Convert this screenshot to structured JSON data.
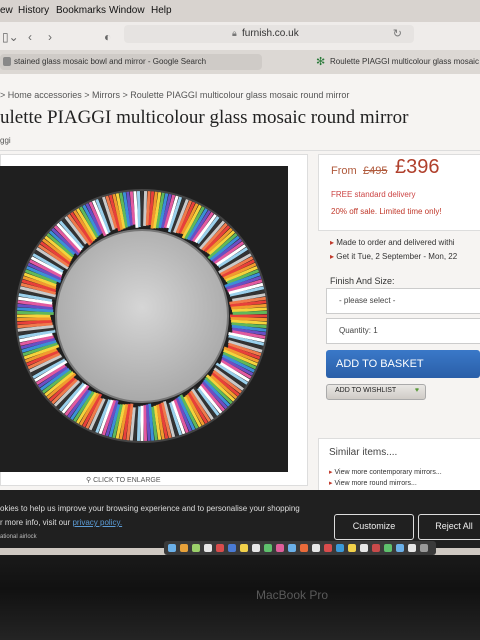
{
  "menubar": {
    "items": [
      "ew",
      "History",
      "Bookmarks",
      "Window",
      "Help"
    ]
  },
  "browser": {
    "url": "furnish.co.uk",
    "tabs": [
      {
        "label": "stained glass mosaic bowl and mirror - Google Search"
      },
      {
        "label": "Roulette PIAGGI multicolour glass mosaic r"
      }
    ]
  },
  "product": {
    "breadcrumb": "> Home accessories > Mirrors > Roulette PIAGGI multicolour glass mosaic round mirror",
    "title": "ulette PIAGGI multicolour glass mosaic round mirror",
    "brand": "ggi",
    "enlarge_label": "CLICK TO ENLARGE",
    "price": {
      "from_label": "From",
      "old_price": "£495",
      "new_price": "£396",
      "delivery": "FREE standard delivery",
      "sale_note": "20% off sale. Limited time only!"
    },
    "details": [
      "Made to order and delivered withi",
      "Get it Tue,  2 September - Mon, 22"
    ],
    "finish_label": "Finish And Size:",
    "finish_select": "- please select -",
    "quantity": "Quantity: 1",
    "add_to_basket": "ADD TO BASKET",
    "add_to_wishlist": "ADD TO WISHLIST",
    "similar_title": "Similar items....",
    "similar_items": [
      "View more contemporary mirrors...",
      "View more round mirrors..."
    ]
  },
  "cookie": {
    "line1": "okies to help us improve your browsing experience and to personalise your shopping",
    "line2_prefix": "r more info, visit our ",
    "privacy_link": "privacy policy.",
    "customize": "Customize",
    "reject_all": "Reject All",
    "status": "ational airlock"
  },
  "laptop_label": "MacBook Pro",
  "colors": {
    "accent_blue": "#2a5fa8",
    "price_red": "#b0402c",
    "sale_red": "#c0392b"
  }
}
